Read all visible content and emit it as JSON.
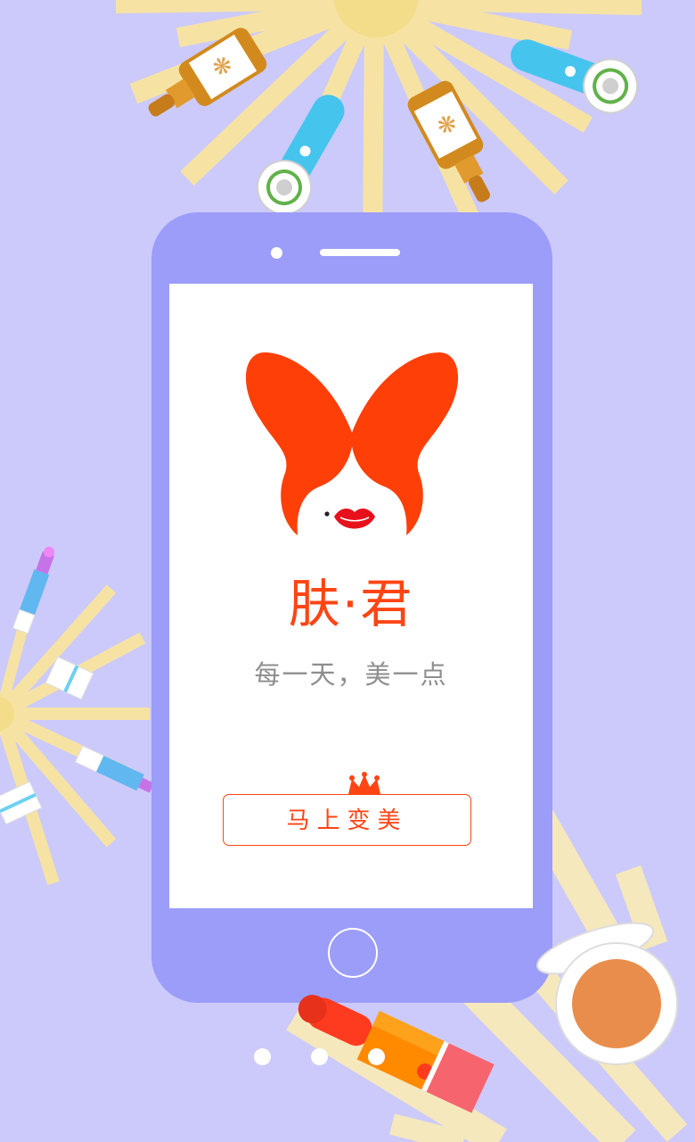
{
  "app": {
    "title": "肤·君",
    "slogan": "每一天，美一点",
    "cta_label": "马上变美"
  },
  "pager": {
    "count": 3,
    "active": 1
  },
  "icons": [
    "butterfly-hair-logo-icon",
    "lips-icon",
    "crown-icon",
    "serum-bottle-icon",
    "face-brush-icon",
    "lipstick-icon",
    "compact-powder-icon",
    "mascara-icon"
  ],
  "colors": {
    "background": "#cccafa",
    "phone_body": "#9c9cf9",
    "brand_orange": "#ff4514",
    "lips_red": "#e8101b",
    "ray_yellow": "#f6eab5",
    "sun_yellow": "#f3dd8a",
    "slogan_gray": "#8e8e8e"
  }
}
